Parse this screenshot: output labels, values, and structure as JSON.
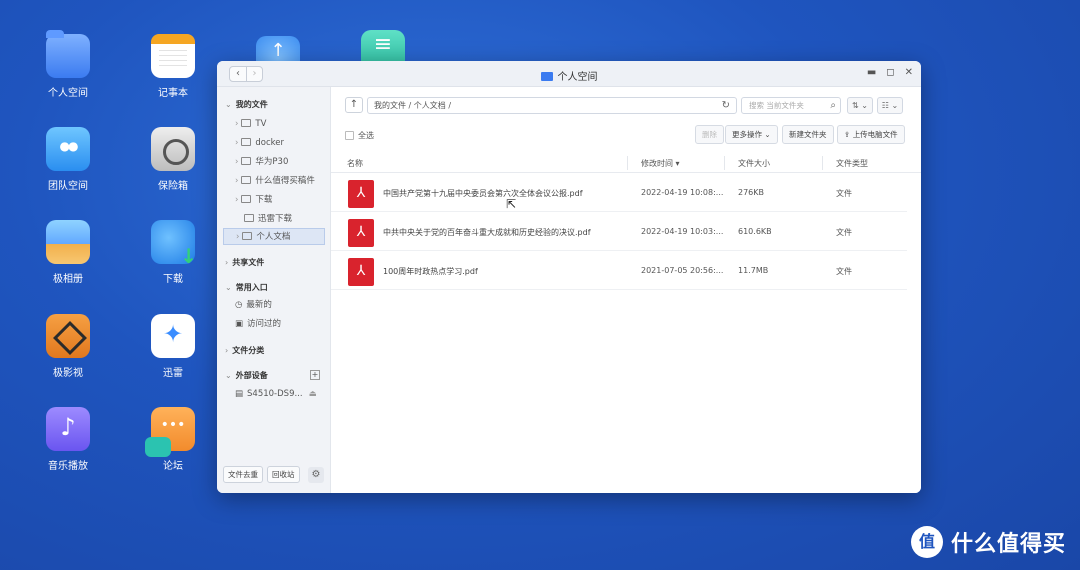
{
  "desktop": {
    "icons": [
      {
        "label": "个人空间"
      },
      {
        "label": "记事本"
      },
      {
        "label": "团队空间"
      },
      {
        "label": "保险箱"
      },
      {
        "label": "极相册"
      },
      {
        "label": "下载"
      },
      {
        "label": "极影视"
      },
      {
        "label": "迅雷"
      },
      {
        "label": "音乐播放"
      },
      {
        "label": "论坛"
      }
    ]
  },
  "window": {
    "title": "个人空间",
    "controls": {
      "minimize": "▬",
      "maximize": "◻",
      "close": "✕"
    },
    "nav": {
      "back": "‹",
      "forward": "›"
    }
  },
  "sidebar": {
    "my_files": "我的文件",
    "folders": [
      "TV",
      "docker",
      "华为P30",
      "什么值得买稿件",
      "下载",
      "迅雷下载",
      "个人文档"
    ],
    "shared": "共享文件",
    "common": "常用入口",
    "recent": "最新的",
    "visited": "访问过的",
    "categories": "文件分类",
    "external": "外部设备",
    "device": "S4510-DS9...",
    "go_to_files": "文件去重",
    "recycle": "回收站"
  },
  "toolbar": {
    "path": "我的文件 / 个人文档 /",
    "search_placeholder": "搜索 当前文件夹",
    "select_all": "全选",
    "delete": "删除",
    "more_ops": "更多操作 ⌄",
    "new_folder": "新建文件夹",
    "upload": "上传电脑文件"
  },
  "table": {
    "headers": {
      "name": "名称",
      "modified": "修改时间 ▾",
      "size": "文件大小",
      "type": "文件类型"
    },
    "rows": [
      {
        "name": "中国共产党第十九届中央委员会第六次全体会议公报.pdf",
        "modified": "2022-04-19 10:08:...",
        "size": "276KB",
        "type": "文件"
      },
      {
        "name": "中共中央关于党的百年奋斗重大成就和历史经验的决议.pdf",
        "modified": "2022-04-19 10:03:...",
        "size": "610.6KB",
        "type": "文件"
      },
      {
        "name": "100周年时政热点学习.pdf",
        "modified": "2021-07-05 20:56:...",
        "size": "11.7MB",
        "type": "文件"
      }
    ]
  },
  "brand": {
    "logo": "值",
    "text": "什么值得买"
  }
}
